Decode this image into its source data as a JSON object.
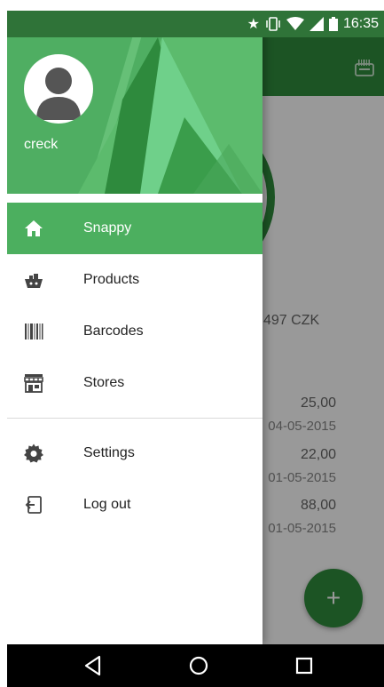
{
  "status_bar": {
    "time": "16:35",
    "icons": [
      "star-icon",
      "vibrate-icon",
      "wifi-icon",
      "signal-icon",
      "battery-icon"
    ]
  },
  "drawer": {
    "user": {
      "name": "creck"
    },
    "menu_items": [
      {
        "label": "Snappy",
        "icon": "home-icon",
        "active": true
      },
      {
        "label": "Products",
        "icon": "basket-icon",
        "active": false
      },
      {
        "label": "Barcodes",
        "icon": "barcode-icon",
        "active": false
      },
      {
        "label": "Stores",
        "icon": "store-icon",
        "active": false
      }
    ],
    "secondary_items": [
      {
        "label": "Settings",
        "icon": "gear-icon"
      },
      {
        "label": "Log out",
        "icon": "logout-icon"
      }
    ]
  },
  "background": {
    "total": "497 CZK",
    "transactions": [
      {
        "amount": "25,00",
        "date": "04-05-2015"
      },
      {
        "amount": "22,00",
        "date": "01-05-2015"
      },
      {
        "amount": "88,00",
        "date": "01-05-2015"
      }
    ],
    "fab_label": "+"
  },
  "colors": {
    "primary": "#4caf5f",
    "primary_dark": "#2f8d3d",
    "status_bar": "#2f7338"
  }
}
